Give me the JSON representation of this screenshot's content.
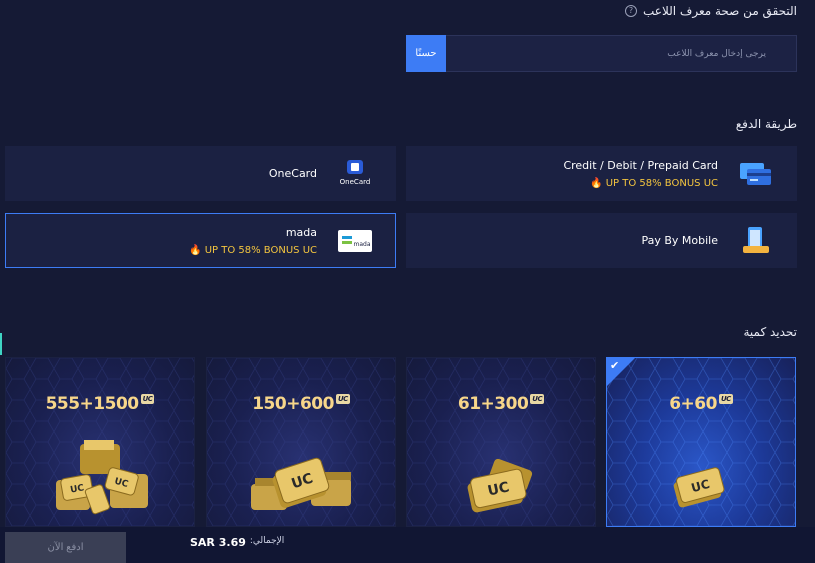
{
  "player_id": {
    "title": "التحقق من صحة معرف اللاعب",
    "help_icon": "?",
    "placeholder": "يرجى إدخال معرف اللاعب",
    "ok_label": "حسنًا"
  },
  "payment": {
    "title": "طريقة الدفع",
    "methods": [
      {
        "name": "Credit / Debit / Prepaid Card",
        "bonus": "UP TO 58% BONUS UC",
        "icon": "credit-card-icon",
        "selected": false
      },
      {
        "name": "OneCard",
        "bonus": "",
        "icon": "onecard-logo",
        "selected": false
      },
      {
        "name": "Pay By Mobile",
        "bonus": "",
        "icon": "mobile-phone-icon",
        "selected": false
      },
      {
        "name": "mada",
        "bonus": "UP TO 58% BONUS UC",
        "icon": "mada-logo",
        "selected": true
      }
    ],
    "onecard_logo_text": "OneCard",
    "mada_logo_text": "mada"
  },
  "packages": {
    "title": "تحديد كمية",
    "items": [
      {
        "amount": "6+60",
        "badge": "UC",
        "selected": true
      },
      {
        "amount": "61+300",
        "badge": "UC",
        "selected": false
      },
      {
        "amount": "150+600",
        "badge": "UC",
        "selected": false
      },
      {
        "amount": "555+1500",
        "badge": "UC",
        "selected": false
      }
    ]
  },
  "footer": {
    "total_label": "الإجمالي:",
    "total_value": "SAR 3.69",
    "pay_now_label": "ادفع الآن"
  },
  "colors": {
    "background": "#151a35",
    "card": "#1b2142",
    "accent": "#3d7cf5",
    "bonus": "#f3c53f",
    "uc_gold": "#f7d68a"
  }
}
